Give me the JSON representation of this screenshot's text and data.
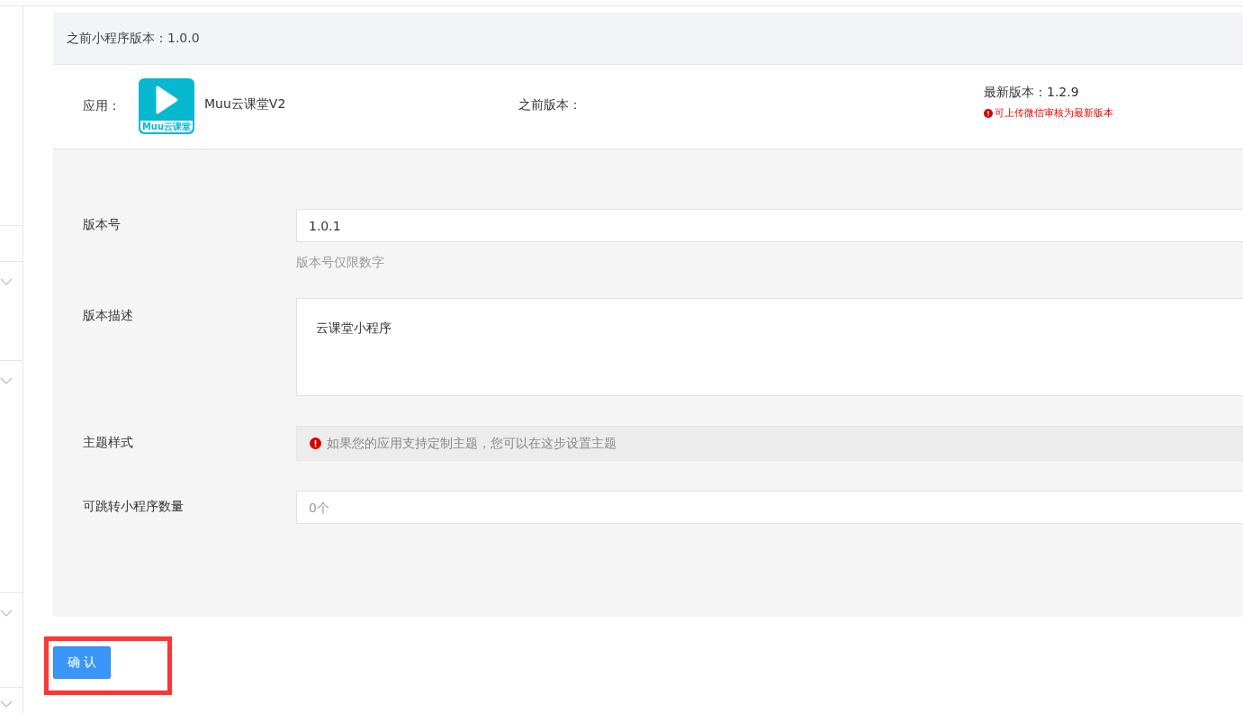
{
  "previous_version_bar": {
    "text": "之前小程序版本：1.0.0"
  },
  "app_info": {
    "app_label": "应用：",
    "app_name": "Muu云课堂V2",
    "icon_caption": "Muu云课堂",
    "previous_version_label": "之前版本：",
    "latest_version": "最新版本：1.2.9",
    "latest_note": "可上传微信审核为最新版本"
  },
  "form": {
    "fields": [
      {
        "kind": "input",
        "label": "版本号",
        "value": "1.0.1",
        "hint": "版本号仅限数字"
      },
      {
        "kind": "textarea",
        "label": "版本描述",
        "value": "云课堂小程序"
      },
      {
        "kind": "notice",
        "label": "主题样式",
        "text": "如果您的应用支持定制主题，您可以在这步设置主题"
      },
      {
        "kind": "input",
        "label": "可跳转小程序数量",
        "placeholder": "0个"
      }
    ]
  },
  "confirm_button": {
    "label": "确 认",
    "highlighted": true
  }
}
